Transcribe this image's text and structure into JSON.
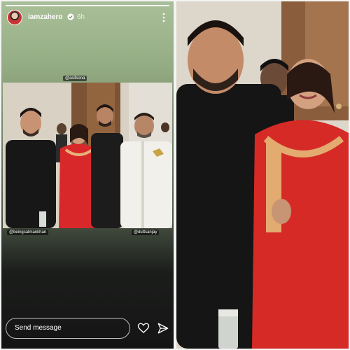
{
  "story": {
    "username": "iamzahero",
    "time": "6h",
    "tags": {
      "top": "@asifsona",
      "left": "@beingsalmankhan",
      "right": "@duttsanjay"
    },
    "reply_placeholder": "Send message"
  },
  "colors": {
    "story_bg_top": "#a9bf98",
    "story_bg_bottom": "#141414",
    "dress_red": "#d8282a",
    "shirt_black": "#161616",
    "kurta_white": "#f2f0ea"
  }
}
